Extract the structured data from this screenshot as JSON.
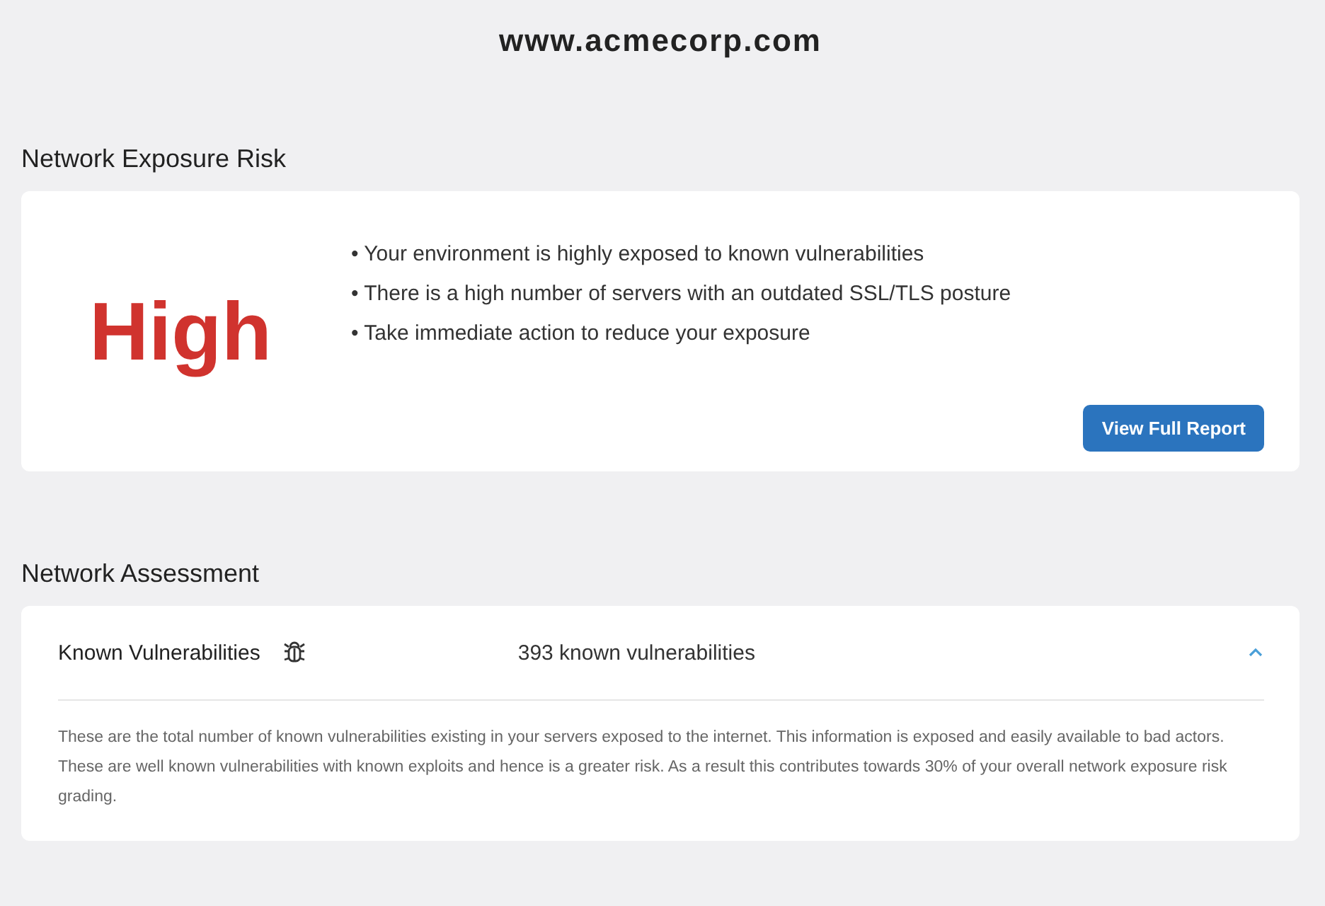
{
  "site_title": "www.acmecorp.com",
  "risk_section": {
    "heading": "Network Exposure Risk",
    "rating": "High",
    "points": [
      "• Your environment is highly exposed to known vulnerabilities",
      "• There is a high number of servers with an outdated SSL/TLS posture",
      "• Take immediate action to reduce your exposure"
    ],
    "button": "View Full Report"
  },
  "assessment_section": {
    "heading": "Network Assessment",
    "items": [
      {
        "label": "Known Vulnerabilities",
        "summary": "393 known vulnerabilities",
        "expanded": true,
        "description": "These are the total number of known vulnerabilities existing in your servers exposed to the internet. This information is exposed and easily available to bad actors. These are well known vulnerabilities with known exploits and hence is a greater risk. As a result this contributes towards 30% of your overall network exposure risk grading."
      }
    ]
  }
}
